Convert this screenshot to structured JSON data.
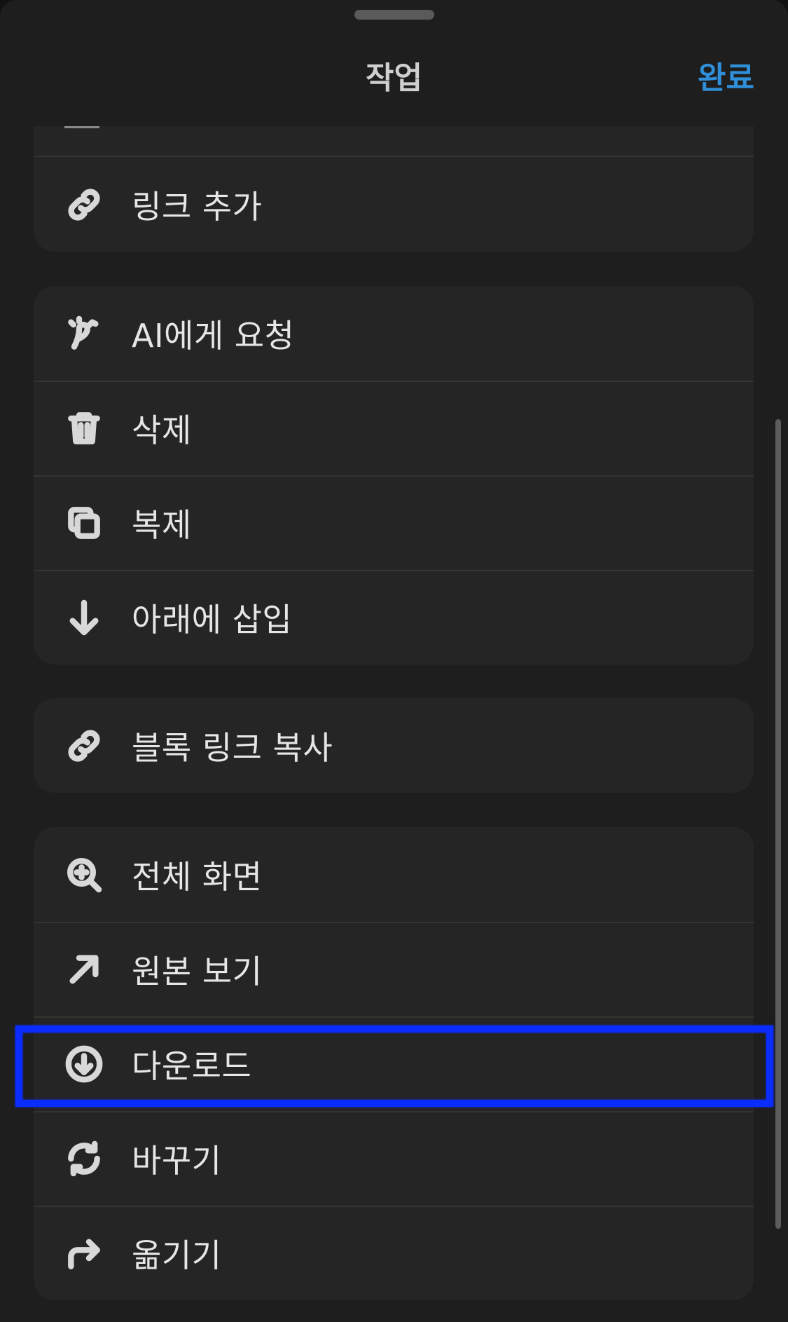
{
  "header": {
    "title": "작업",
    "done_label": "완료"
  },
  "groups": [
    {
      "items": [
        {
          "icon": "link-icon",
          "label": "링크 추가"
        }
      ]
    },
    {
      "items": [
        {
          "icon": "ai-icon",
          "label": "AI에게 요청"
        },
        {
          "icon": "trash-icon",
          "label": "삭제"
        },
        {
          "icon": "duplicate-icon",
          "label": "복제"
        },
        {
          "icon": "arrow-down-icon",
          "label": "아래에 삽입"
        }
      ]
    },
    {
      "items": [
        {
          "icon": "link-icon",
          "label": "블록 링크 복사"
        }
      ]
    },
    {
      "items": [
        {
          "icon": "zoom-in-icon",
          "label": "전체 화면"
        },
        {
          "icon": "arrow-up-right-icon",
          "label": "원본 보기"
        },
        {
          "icon": "download-icon",
          "label": "다운로드"
        },
        {
          "icon": "replace-icon",
          "label": "바꾸기"
        },
        {
          "icon": "move-icon",
          "label": "옮기기"
        }
      ]
    }
  ],
  "colors": {
    "sheet_bg": "#1e1e1e",
    "group_bg": "#252525",
    "accent": "#2f8fd8",
    "highlight": "#0a2cff"
  }
}
